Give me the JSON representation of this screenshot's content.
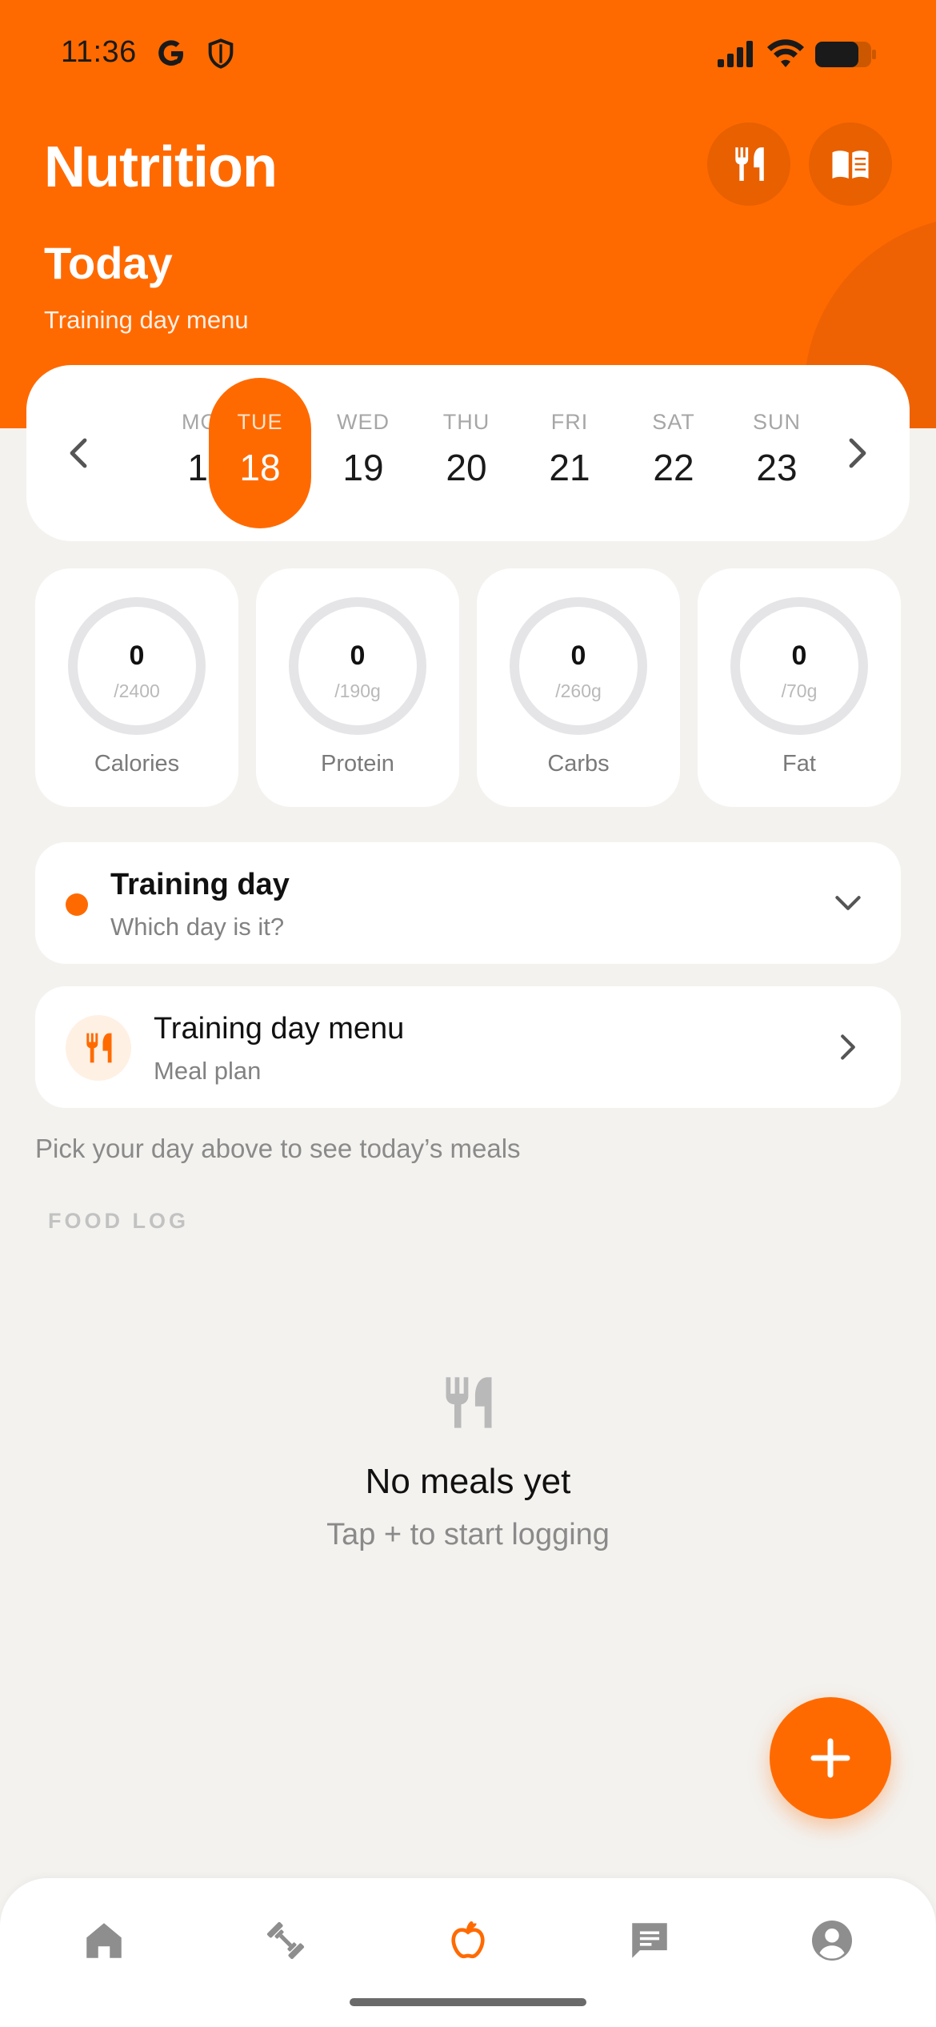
{
  "status_bar": {
    "time": "11:36",
    "icons": [
      "google-icon",
      "shield-icon",
      "signal-icon",
      "wifi-icon",
      "battery-icon"
    ]
  },
  "header": {
    "title": "Nutrition",
    "day_title": "Today",
    "subtitle": "Training day menu",
    "buttons": [
      "meal-plan-icon",
      "recipe-book-icon"
    ],
    "background_color": "#ff6a00"
  },
  "week": {
    "days": [
      {
        "name": "MON",
        "date": "17",
        "selected": false
      },
      {
        "name": "TUE",
        "date": "18",
        "selected": true
      },
      {
        "name": "WED",
        "date": "19",
        "selected": false
      },
      {
        "name": "THU",
        "date": "20",
        "selected": false
      },
      {
        "name": "FRI",
        "date": "21",
        "selected": false
      },
      {
        "name": "SAT",
        "date": "22",
        "selected": false
      },
      {
        "name": "SUN",
        "date": "23",
        "selected": false
      }
    ]
  },
  "macros": [
    {
      "value": "0",
      "goal": "/2400",
      "label": "Calories"
    },
    {
      "value": "0",
      "goal": "/190g",
      "label": "Protein"
    },
    {
      "value": "0",
      "goal": "/260g",
      "label": "Carbs"
    },
    {
      "value": "0",
      "goal": "/70g",
      "label": "Fat"
    }
  ],
  "day_type": {
    "title": "Training day",
    "subtitle": "Which day is it?"
  },
  "menu_card": {
    "title": "Training day menu",
    "subtitle": "Meal plan"
  },
  "hint": "Pick your day above to see today’s meals",
  "food_log": {
    "section_label": "FOOD LOG",
    "empty_title": "No meals yet",
    "empty_subtitle": "Tap + to start logging"
  },
  "fab": {
    "icon": "plus-icon",
    "color": "#ff6a00"
  },
  "tabs": [
    {
      "name": "home",
      "icon": "home-icon",
      "active": false
    },
    {
      "name": "workouts",
      "icon": "dumbbell-icon",
      "active": false
    },
    {
      "name": "nutrition",
      "icon": "apple-icon",
      "active": true
    },
    {
      "name": "messages",
      "icon": "chat-icon",
      "active": false
    },
    {
      "name": "profile",
      "icon": "profile-icon",
      "active": false
    }
  ],
  "colors": {
    "accent": "#ff6a00",
    "inactive_tab": "#8e8e8e",
    "background": "#f3f2ef"
  }
}
